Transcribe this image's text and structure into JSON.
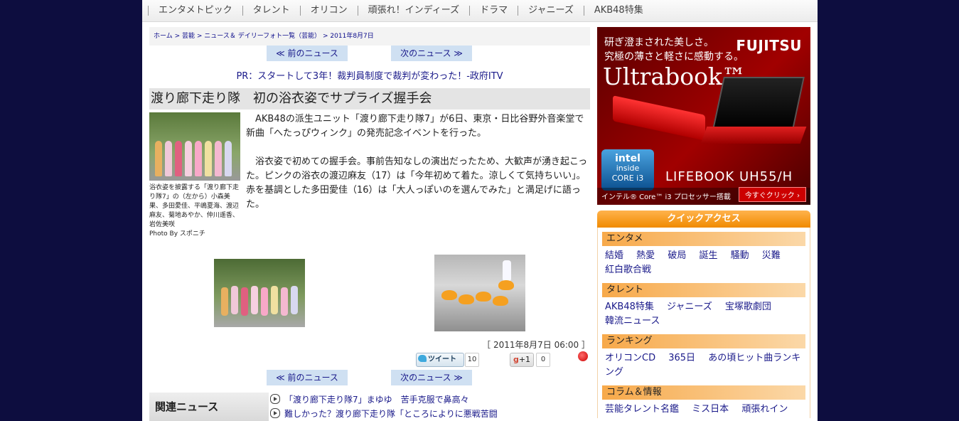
{
  "nav": {
    "items": [
      "エンタメトピック",
      "タレント",
      "オリコン",
      "頑張れ！インディーズ",
      "ドラマ",
      "ジャニーズ",
      "AKB48特集"
    ]
  },
  "breadcrumb": {
    "home": "ホーム",
    "geinou": "芸能",
    "list": "ニュース＆ デイリーフォト一覧（芸能）",
    "date": "2011年8月7日"
  },
  "pager": {
    "prev": "≪ 前のニュース",
    "next": "次のニュース ≫"
  },
  "pr_text": "PR：スタートして3年！裁判員制度で裁判が変わった！-政府ITV",
  "article": {
    "title": "渡り廊下走り隊　初の浴衣姿でサプライズ握手会",
    "paragraph1": "AKB48の派生ユニット「渡り廊下走り隊7」が6日、東京・日比谷野外音楽堂で新曲「へたっぴウィンク」の発売記念イベントを行った。",
    "paragraph2": "浴衣姿で初めての握手会。事前告知なしの演出だったため、大歓声が湧き起こった。ピンクの浴衣の渡辺麻友（17）は「今年初めて着た。涼しくて気持ちいい」。赤を基調とした多田愛佳（16）は「大人っぽいのを選んでみた」と満足げに語った。",
    "caption": "浴衣姿を披露する「渡り廊下走り隊7」の（左から）小森美果、多田愛佳、平嶋夏海、渡辺麻友、菊地あやか、仲川遥香、岩佐美咲",
    "photo_credit": "Photo By スポニチ",
    "date": "［ 2011年8月7日 06:00 ］"
  },
  "social": {
    "tweet_label": "ツイート",
    "tweet_count": "10",
    "gplus_label": "+1",
    "gplus_count": "0"
  },
  "related": {
    "heading": "関連ニュース",
    "items": [
      "「渡り廊下走り隊7」まゆゆ　苦手克服で鼻高々",
      "難しかった？渡り廊下走り隊「ところによりに悪戦苦闘"
    ]
  },
  "ad": {
    "line1": "研ぎ澄まされた美しさ。",
    "line2": "究極の薄さと軽さに感動する。",
    "brand": "FUJITSU",
    "product": "Ultrabook™",
    "intel_top": "intel",
    "intel_mid": "inside",
    "intel_bottom": "CORE i3",
    "model": "LIFEBOOK UH55/H",
    "processor": "インテル® Core™ i3 プロセッサー搭載",
    "cta": "今すぐクリック ›"
  },
  "quick_access": {
    "title": "クイックアクセス",
    "sections": [
      {
        "head": "エンタメ",
        "links": [
          "結婚",
          "熱愛",
          "破局",
          "誕生",
          "騒動",
          "災難",
          "紅白歌合戦"
        ]
      },
      {
        "head": "タレント",
        "links": [
          "AKB48特集",
          "ジャニーズ",
          "宝塚歌劇団",
          "韓流ニュース"
        ]
      },
      {
        "head": "ランキング",
        "links": [
          "オリコンCD",
          "365日",
          "あの頃ヒット曲ランキング"
        ]
      },
      {
        "head": "コラム＆情報",
        "links": [
          "芸能タレント名鑑",
          "ミス日本",
          "頑張れイン"
        ]
      }
    ]
  },
  "colors": {
    "background": "#0d0d3f",
    "link": "#1a1a8a",
    "quick_header": "#f08a00"
  }
}
